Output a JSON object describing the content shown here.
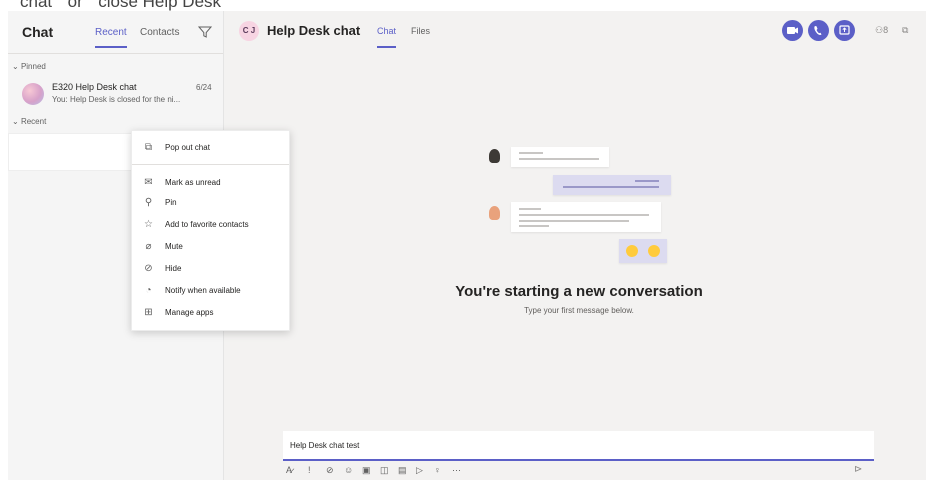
{
  "top_cut_text": "chat \" or \" close Help Desk \"",
  "sidebar": {
    "title": "Chat",
    "tabs": [
      {
        "label": "Recent",
        "active": true
      },
      {
        "label": "Contacts",
        "active": false
      }
    ],
    "filter_icon": "filter-icon",
    "pinned_label": "Pinned",
    "recent_label": "Recent",
    "pinned_chat": {
      "name": "E320 Help Desk chat",
      "date": "6/24",
      "preview": "You: Help Desk is closed for the ni..."
    }
  },
  "context_menu": {
    "items": [
      {
        "icon": "pop-out-icon",
        "label": "Pop out chat"
      },
      {
        "icon": "mark-unread-icon",
        "label": "Mark as unread"
      },
      {
        "icon": "pin-icon",
        "label": "Pin"
      },
      {
        "icon": "add-contact-icon",
        "label": "Add to favorite contacts"
      },
      {
        "icon": "mute-icon",
        "label": "Mute"
      },
      {
        "icon": "hide-icon",
        "label": "Hide"
      },
      {
        "icon": "notify-icon",
        "label": "Notify when available"
      },
      {
        "icon": "manage-apps-icon",
        "label": "Manage apps"
      }
    ]
  },
  "header": {
    "avatar_initials": "C J",
    "title": "Help Desk chat",
    "tabs": [
      {
        "label": "Chat",
        "active": true
      },
      {
        "label": "Files",
        "active": false
      }
    ],
    "participants_label": "8",
    "accent": "#5b5fc7"
  },
  "empty_state": {
    "title": "You're starting a new conversation",
    "subtitle": "Type your first message below."
  },
  "compose": {
    "value": "Help Desk chat test"
  }
}
